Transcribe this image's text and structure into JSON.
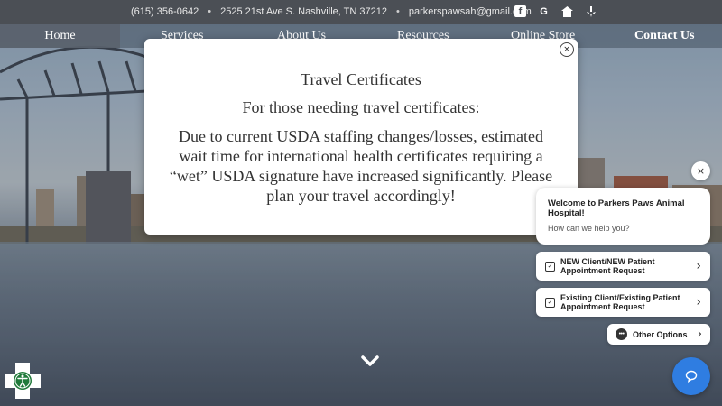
{
  "topbar": {
    "phone": "(615) 356-0642",
    "address": "2525 21st Ave S. Nashville, TN 37212",
    "email": "parkerspawsah@gmail.com",
    "separator": "•",
    "socials": [
      "facebook-icon",
      "google-icon",
      "nextdoor-icon",
      "yelp-icon"
    ]
  },
  "nav": {
    "items": [
      "Home",
      "Services",
      "About Us",
      "Resources",
      "Online Store",
      "Contact Us"
    ]
  },
  "modal": {
    "close_label": "×",
    "title": "Travel Certificates",
    "subtitle": "For those needing travel certificates:",
    "body": "Due to current USDA staffing changes/losses, estimated wait time for international health certificates requiring a “wet” USDA signature have increased significantly. Please plan your travel accordingly!"
  },
  "chat": {
    "close_label": "×",
    "welcome_title": "Welcome to Parkers Paws Animal Hospital!",
    "welcome_sub": "How can we help you?",
    "options": [
      "NEW Client/NEW Patient Appointment Request",
      "Existing Client/Existing Patient Appointment Request"
    ],
    "other_label": "Other Options",
    "chevron": "›"
  },
  "colors": {
    "topbar_bg": "#4b4f55",
    "chat_accent": "#2f7de1",
    "a11y_green": "#1f7a3a"
  }
}
